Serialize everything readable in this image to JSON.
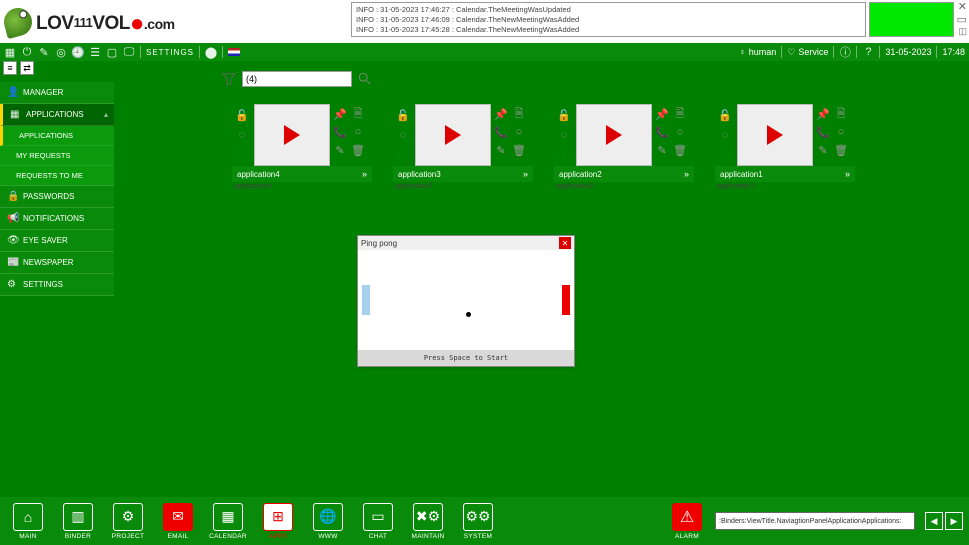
{
  "logo": {
    "pre": "LOV",
    "mid": "111",
    "post": "VOL",
    "dot": "●",
    "com": ".com"
  },
  "info_lines": [
    "INFO : 31-05-2023 17:46:27 : Calendar.TheMeetingWasUpdated",
    "INFO : 31-05-2023 17:46:09 : Calendar.TheNewMeetingWasAdded",
    "INFO : 31-05-2023 17:45:28 : Calendar.TheNewMeetingWasAdded"
  ],
  "toolbar": {
    "settings": "SETTINGS",
    "user_icon": "♀",
    "user": "human",
    "service": "Service",
    "date": "31-05-2023",
    "time": "17:48"
  },
  "sidebar": {
    "items": [
      {
        "icon": "👤",
        "label": "MANAGER"
      },
      {
        "icon": "▦",
        "label": "APPLICATIONS",
        "active": true
      },
      {
        "icon": "🔒",
        "label": "PASSWORDS"
      },
      {
        "icon": "📢",
        "label": "NOTIFICATIONS"
      },
      {
        "icon": "👁",
        "label": "EYE SAVER"
      },
      {
        "icon": "📰",
        "label": "NEWSPAPER"
      },
      {
        "icon": "⚙",
        "label": "SETTINGS"
      }
    ],
    "subs": [
      "APPLICATIONS",
      "MY REQUESTS",
      "REQUESTS TO ME"
    ]
  },
  "filter": {
    "value": "(4)"
  },
  "cards": [
    {
      "title": "application4",
      "sub": "application4",
      "pin": "red"
    },
    {
      "title": "application3",
      "sub": "application3",
      "pin": "orange"
    },
    {
      "title": "application2",
      "sub": "application2",
      "pin": "green"
    },
    {
      "title": "application1",
      "sub": "application1",
      "pin": "grey"
    }
  ],
  "pong": {
    "title": "Ping pong",
    "footer": "Press Space to Start"
  },
  "dock": [
    {
      "label": "MAIN",
      "glyph": "⌂"
    },
    {
      "label": "BINDER",
      "glyph": "▥"
    },
    {
      "label": "PROJECT",
      "glyph": "⚙"
    },
    {
      "label": "EMAIL",
      "glyph": "✉",
      "style": "red"
    },
    {
      "label": "CALENDAR",
      "glyph": "▦"
    },
    {
      "label": "APPS",
      "glyph": "⊞",
      "style": "white"
    },
    {
      "label": "WWW",
      "glyph": "🌐"
    },
    {
      "label": "CHAT",
      "glyph": "▭"
    },
    {
      "label": "MAINTAIN",
      "glyph": "✖⚙"
    },
    {
      "label": "SYSTEM",
      "glyph": "⚙⚙"
    }
  ],
  "alarm": {
    "label": "ALARM"
  },
  "status_text": ":Binders:ViewTitle.NaviagtionPanelApplicationApplications:"
}
